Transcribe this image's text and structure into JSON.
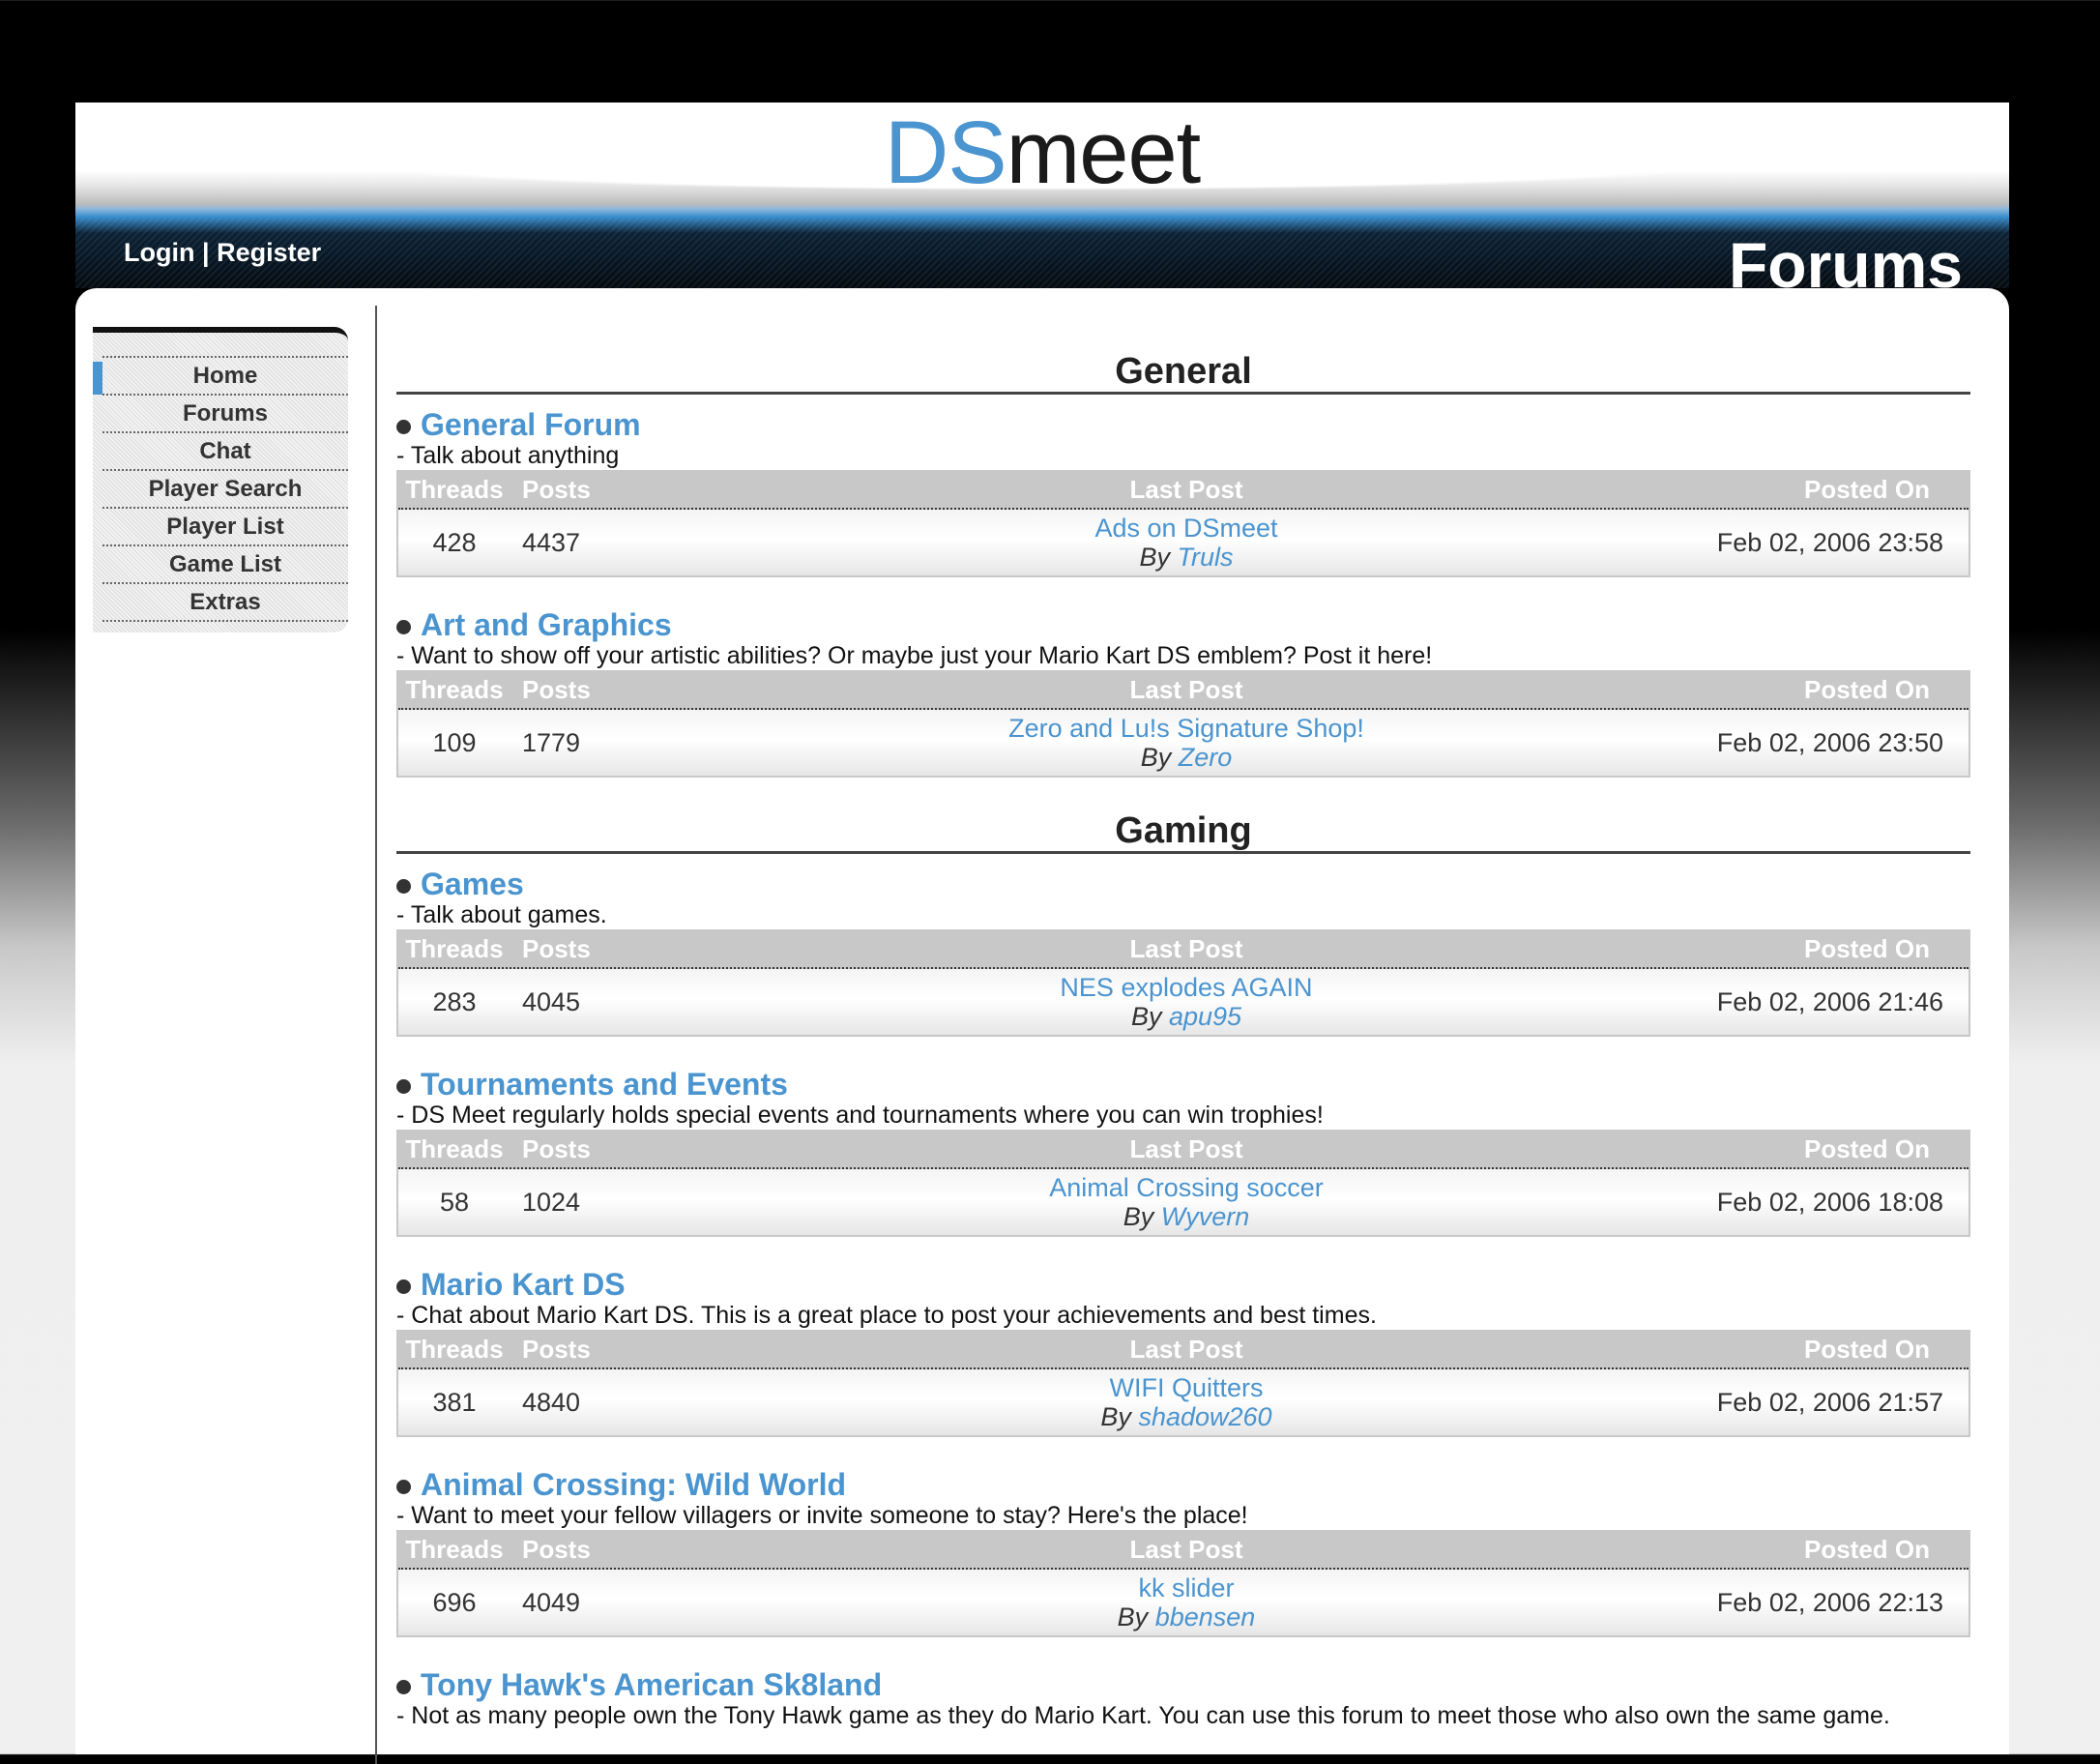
{
  "header": {
    "logo_ds": "DS",
    "logo_meet": "meet",
    "login": "Login",
    "separator": "|",
    "register": "Register",
    "section_title": "Forums"
  },
  "nav": [
    "Home",
    "Forums",
    "Chat",
    "Player Search",
    "Player List",
    "Game List",
    "Extras"
  ],
  "table_headers": {
    "threads": "Threads",
    "posts": "Posts",
    "last_post": "Last Post",
    "posted_on": "Posted On"
  },
  "by_label": "By",
  "categories": [
    {
      "title": "General",
      "forums": [
        {
          "name": "General Forum",
          "desc": "- Talk about anything",
          "threads": "428",
          "posts": "4437",
          "last_title": "Ads on DSmeet",
          "last_user": "Truls",
          "posted_on": "Feb 02, 2006 23:58"
        },
        {
          "name": "Art and Graphics",
          "desc": "- Want to show off your artistic abilities? Or maybe just your Mario Kart DS emblem? Post it here!",
          "threads": "109",
          "posts": "1779",
          "last_title": "Zero and Lu!s Signature Shop!",
          "last_user": "Zero",
          "posted_on": "Feb 02, 2006 23:50"
        }
      ]
    },
    {
      "title": "Gaming",
      "forums": [
        {
          "name": "Games",
          "desc": "- Talk about games.",
          "threads": "283",
          "posts": "4045",
          "last_title": "NES explodes AGAIN",
          "last_user": "apu95",
          "posted_on": "Feb 02, 2006 21:46"
        },
        {
          "name": "Tournaments and Events",
          "desc": "- DS Meet regularly holds special events and tournaments where you can win trophies!",
          "threads": "58",
          "posts": "1024",
          "last_title": "Animal Crossing soccer",
          "last_user": "Wyvern",
          "posted_on": "Feb 02, 2006 18:08"
        },
        {
          "name": "Mario Kart DS",
          "desc": "- Chat about Mario Kart DS. This is a great place to post your achievements and best times.",
          "threads": "381",
          "posts": "4840",
          "last_title": "WIFI Quitters",
          "last_user": "shadow260",
          "posted_on": "Feb 02, 2006 21:57"
        },
        {
          "name": "Animal Crossing: Wild World",
          "desc": "- Want to meet your fellow villagers or invite someone to stay? Here's the place!",
          "threads": "696",
          "posts": "4049",
          "last_title": "kk slider",
          "last_user": "bbensen",
          "posted_on": "Feb 02, 2006 22:13"
        },
        {
          "name": "Tony Hawk's American Sk8land",
          "desc": "- Not as many people own the Tony Hawk game as they do Mario Kart. You can use this forum to meet those who also own the same game."
        }
      ]
    }
  ]
}
